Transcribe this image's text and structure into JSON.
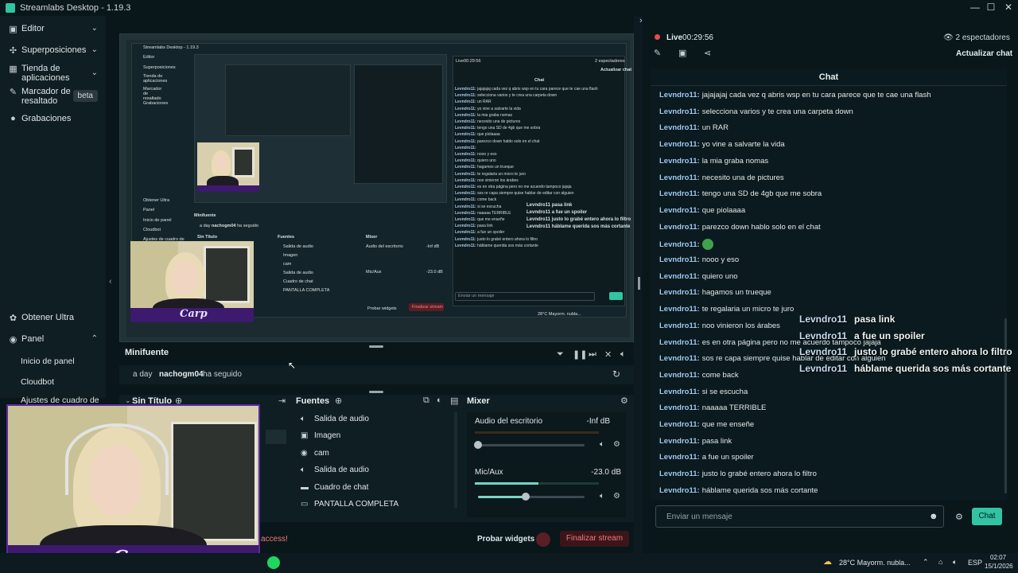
{
  "app": {
    "title": "Streamlabs Desktop - 1.19.3"
  },
  "sidebar": {
    "items": [
      {
        "label": "Editor"
      },
      {
        "label": "Superposiciones"
      },
      {
        "label": "Tienda de aplicaciones"
      },
      {
        "label": "Marcador de resaltado",
        "badge": "beta"
      },
      {
        "label": "Grabaciones"
      }
    ],
    "bottom_items": [
      {
        "label": "Obtener Ultra"
      },
      {
        "label": "Panel"
      }
    ],
    "panel_sub": [
      "Inicio de panel",
      "Cloudbot",
      "Ajustes de cuadro de"
    ]
  },
  "minifuente": {
    "title": "Minifuente",
    "event": {
      "time": "a day",
      "user": "nachogm04",
      "action": "ha seguido"
    }
  },
  "scenes": {
    "title": "Sin Título"
  },
  "sources": {
    "title": "Fuentes",
    "items": [
      {
        "label": "Salida de audio",
        "icon": "speaker-icon"
      },
      {
        "label": "Imagen",
        "icon": "image-icon"
      },
      {
        "label": "cam",
        "icon": "camera-icon"
      },
      {
        "label": "Salida de audio",
        "icon": "speaker-icon"
      },
      {
        "label": "Cuadro de chat",
        "icon": "chat-icon"
      },
      {
        "label": "PANTALLA COMPLETA",
        "icon": "monitor-icon"
      }
    ]
  },
  "mixer": {
    "title": "Mixer",
    "channels": [
      {
        "name": "Audio del escritorio",
        "value": "-Inf dB",
        "level": 0.0
      },
      {
        "name": "Mic/Aux",
        "value": "-23.0 dB",
        "level": 0.45
      }
    ]
  },
  "footer": {
    "access_text": "access!",
    "test_widgets": "Probar widgets",
    "end_stream": "Finalizar stream"
  },
  "live": {
    "status": "Live",
    "time": "00:29:56",
    "viewers": "2 espectadores",
    "refresh_chat": "Actualizar chat"
  },
  "chat": {
    "title": "Chat",
    "messages": [
      {
        "user": "Levndro11:",
        "text": "jajajajaj cada vez q abris wsp en tu cara parece que te cae una flash"
      },
      {
        "user": "Levndro11:",
        "text": "selecciona varios y te crea una carpeta down"
      },
      {
        "user": "Levndro11:",
        "text": "un RAR"
      },
      {
        "user": "Levndro11:",
        "text": "yo vine a salvarte la vida"
      },
      {
        "user": "Levndro11:",
        "text": "la mia graba nomas"
      },
      {
        "user": "Levndro11:",
        "text": "necesito una de pictures"
      },
      {
        "user": "Levndro11:",
        "text": "tengo una SD de 4gb que me sobra"
      },
      {
        "user": "Levndro11:",
        "text": "que piolaaaa"
      },
      {
        "user": "Levndro11:",
        "text": "parezco down hablo solo en el chat"
      },
      {
        "user": "Levndro11:",
        "text": ""
      },
      {
        "user": "Levndro11:",
        "text": "nooo y eso"
      },
      {
        "user": "Levndro11:",
        "text": "quiero uno"
      },
      {
        "user": "Levndro11:",
        "text": "hagamos un trueque"
      },
      {
        "user": "Levndro11:",
        "text": "te regalaria un micro te juro"
      },
      {
        "user": "Levndro11:",
        "text": "noo vinieron los árabes"
      },
      {
        "user": "Levndro11:",
        "text": "es en otra página pero no me acuerdo tampoco jajaja"
      },
      {
        "user": "Levndro11:",
        "text": "sos re capa siempre quise hablar de editar con alguien"
      },
      {
        "user": "Levndro11:",
        "text": "come back"
      },
      {
        "user": "Levndro11:",
        "text": "si se escucha"
      },
      {
        "user": "Levndro11:",
        "text": "naaaaa TERRIBLE"
      },
      {
        "user": "Levndro11:",
        "text": "que me enseñe"
      },
      {
        "user": "Levndro11:",
        "text": "pasa link"
      },
      {
        "user": "Levndro11:",
        "text": "a fue un spoiler"
      },
      {
        "user": "Levndro11:",
        "text": "justo lo grabé entero ahora lo filtro"
      },
      {
        "user": "Levndro11:",
        "text": "háblame querida sos más cortante"
      }
    ],
    "overlay": [
      {
        "user": "Levndro11",
        "text": "pasa link"
      },
      {
        "user": "Levndro11",
        "text": "a fue un spoiler"
      },
      {
        "user": "Levndro11",
        "text": "justo lo grabé entero ahora lo filtro"
      },
      {
        "user": "Levndro11",
        "text": "háblame querida sos más cortante"
      }
    ],
    "input_placeholder": "Enviar un mensaje",
    "send_label": "Chat"
  },
  "taskbar": {
    "weather": "28°C  Mayorm. nubla...",
    "lang": "ESP",
    "time": "02:07",
    "date": "15/1/2026"
  },
  "colors": {
    "accent": "#31c3a2",
    "live_red": "#e05050",
    "band_purple": "#3d1a6e"
  }
}
